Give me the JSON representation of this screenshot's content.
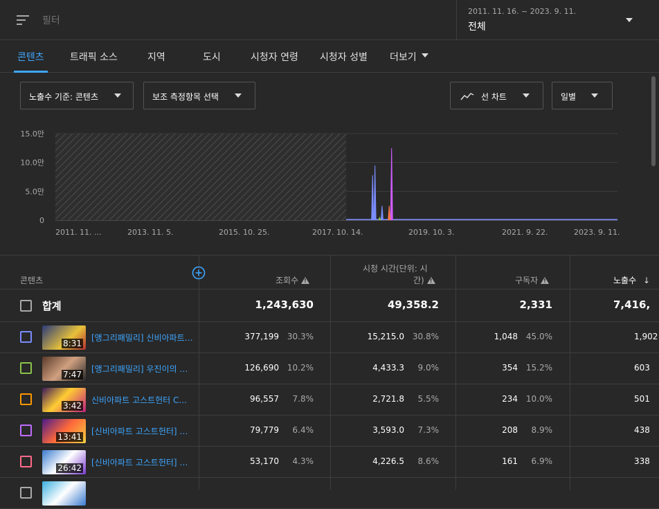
{
  "filter": {
    "placeholder": "필터"
  },
  "date": {
    "range": "2011. 11. 16. ~ 2023. 9. 11.",
    "value": "전체"
  },
  "tabs": [
    {
      "label": "콘텐츠",
      "active": true
    },
    {
      "label": "트래픽 소스"
    },
    {
      "label": "지역"
    },
    {
      "label": "도시"
    },
    {
      "label": "시청자 연령"
    },
    {
      "label": "시청자 성별"
    },
    {
      "label": "더보기"
    }
  ],
  "controls": {
    "metric": "노출수 기준: 콘텐츠",
    "secondary": "보조 측정항목 선택",
    "chart_type": "선 차트",
    "interval": "일별"
  },
  "chart_data": {
    "type": "line",
    "y_ticks": [
      "15.0만",
      "10.0만",
      "5.0만",
      "0"
    ],
    "ylim": [
      0,
      150000
    ],
    "x_ticks": [
      "2011. 11. ...",
      "2013. 11. 5.",
      "2015. 10. 25.",
      "2017. 10. 14.",
      "2019. 10. 3.",
      "2021. 9. 22.",
      "2023. 9. 11."
    ],
    "series": [
      {
        "color": "#7b8cff",
        "peaks": [
          [
            2018.55,
            78000
          ],
          [
            2018.6,
            95000
          ],
          [
            2018.75,
            25000
          ],
          [
            2018.9,
            15000
          ]
        ]
      },
      {
        "color": "#d05cff",
        "peaks": [
          [
            2018.95,
            125000
          ]
        ]
      },
      {
        "color": "#ff7a45",
        "peaks": [
          [
            2018.9,
            25000
          ]
        ]
      },
      {
        "color": "#8bc34a",
        "peaks": [
          [
            2018.7,
            5000
          ]
        ]
      }
    ]
  },
  "table": {
    "headers": {
      "content": "콘텐츠",
      "views": "조회수",
      "watch": "시청 시간(단위: 시",
      "watch2": "간)",
      "subs": "구독자",
      "impr": "노출수"
    },
    "total": {
      "label": "합계",
      "views": "1,243,630",
      "watch": "49,358.2",
      "subs": "2,331",
      "impr": "7,416,"
    },
    "rows": [
      {
        "color": "#7b8cff",
        "duration": "8:31",
        "title": "[앵그리패밀리] 신비아파트 ...",
        "views": "377,199",
        "views_pct": "30.3%",
        "watch": "15,215.0",
        "watch_pct": "30.8%",
        "subs": "1,048",
        "subs_pct": "45.0%",
        "impr": "1,902"
      },
      {
        "color": "#8bc34a",
        "duration": "7:47",
        "title": "[앵그리패밀리] 우진이의 신...",
        "views": "126,690",
        "views_pct": "10.2%",
        "watch": "4,433.3",
        "watch_pct": "9.0%",
        "subs": "354",
        "subs_pct": "15.2%",
        "impr": "603"
      },
      {
        "color": "#ff9800",
        "duration": "3:42",
        "title": "신비아파트 고스트헌터 C...",
        "views": "96,557",
        "views_pct": "7.8%",
        "watch": "2,721.8",
        "watch_pct": "5.5%",
        "subs": "234",
        "subs_pct": "10.0%",
        "impr": "501"
      },
      {
        "color": "#c06cff",
        "duration": "13:41",
        "title": "[신비아파트 고스트헌터] G...",
        "views": "79,779",
        "views_pct": "6.4%",
        "watch": "3,593.0",
        "watch_pct": "7.3%",
        "subs": "208",
        "subs_pct": "8.9%",
        "impr": "438"
      },
      {
        "color": "#ff6b8a",
        "duration": "26:42",
        "title": "[신비아파트 고스트헌터] 기...",
        "views": "53,170",
        "views_pct": "4.3%",
        "watch": "4,226.5",
        "watch_pct": "8.6%",
        "subs": "161",
        "subs_pct": "6.9%",
        "impr": "338"
      },
      {
        "color": "#aaaaaa",
        "duration": "",
        "title": "",
        "views": "",
        "views_pct": "",
        "watch": "",
        "watch_pct": "",
        "subs": "",
        "subs_pct": "",
        "impr": ""
      }
    ]
  }
}
